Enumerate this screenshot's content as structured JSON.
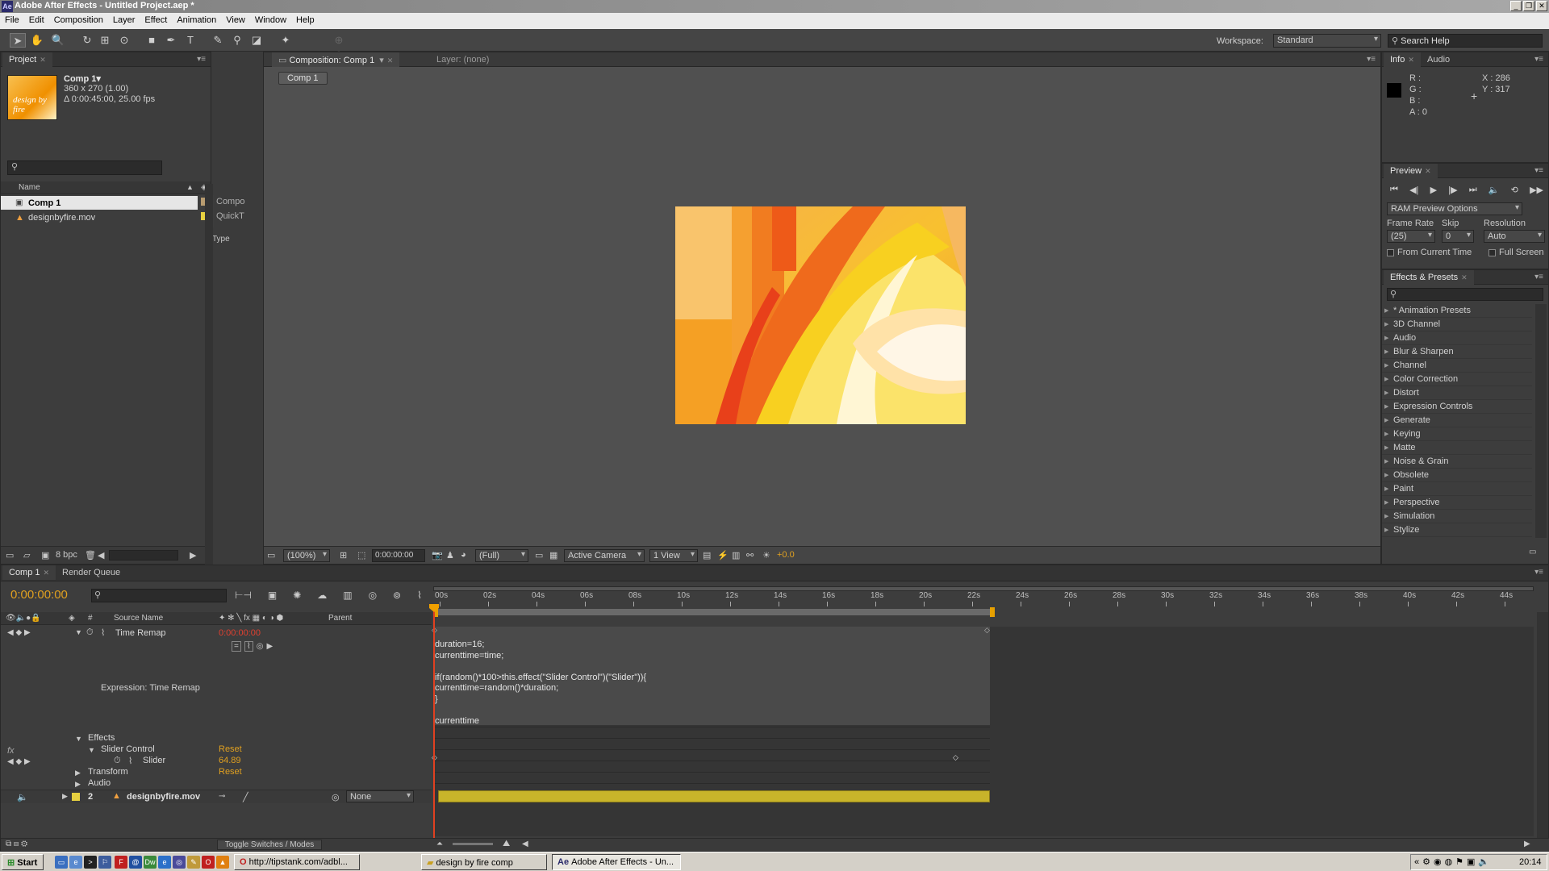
{
  "window": {
    "title": "Adobe After Effects - Untitled Project.aep *"
  },
  "menu": [
    "File",
    "Edit",
    "Composition",
    "Layer",
    "Effect",
    "Animation",
    "View",
    "Window",
    "Help"
  ],
  "toolbar": {
    "workspace_label": "Workspace:",
    "workspace_value": "Standard",
    "search_placeholder": "Search Help"
  },
  "project": {
    "tab": "Project",
    "comp_name": "Comp 1▾",
    "comp_size": "360 x 270 (1.00)",
    "comp_duration": "Δ 0:00:45:00, 25.00 fps",
    "thumb_text": "design by fire",
    "col_name": "Name",
    "col_type": "Type",
    "items": [
      {
        "name": "Comp 1",
        "type": "Compo"
      },
      {
        "name": "designbyfire.mov",
        "type": "QuickT"
      }
    ],
    "bpc": "8 bpc"
  },
  "composition": {
    "tab": "Composition: Comp 1",
    "layer_tab": "Layer: (none)",
    "subtab": "Comp 1",
    "zoom": "(100%)",
    "timecode": "0:00:00:00",
    "resolution": "(Full)",
    "camera": "Active Camera",
    "views": "1 View",
    "exposure": "+0.0"
  },
  "info": {
    "tab": "Info",
    "audio_tab": "Audio",
    "r": "R :",
    "g": "G :",
    "b": "B :",
    "a": "A : 0",
    "x": "X : 286",
    "y": "Y : 317"
  },
  "preview": {
    "tab": "Preview",
    "ram_options": "RAM Preview Options",
    "frame_rate_label": "Frame Rate",
    "skip_label": "Skip",
    "resolution_label": "Resolution",
    "frame_rate": "(25)",
    "skip": "0",
    "resolution": "Auto",
    "from_current": "From Current Time",
    "full_screen": "Full Screen"
  },
  "effects_presets": {
    "tab": "Effects & Presets",
    "items": [
      "* Animation Presets",
      "3D Channel",
      "Audio",
      "Blur & Sharpen",
      "Channel",
      "Color Correction",
      "Distort",
      "Expression Controls",
      "Generate",
      "Keying",
      "Matte",
      "Noise & Grain",
      "Obsolete",
      "Paint",
      "Perspective",
      "Simulation",
      "Stylize"
    ]
  },
  "timeline": {
    "tab": "Comp 1",
    "render_tab": "Render Queue",
    "timecode": "0:00:00:00",
    "col_source": "Source Name",
    "col_parent": "Parent",
    "time_remap": "Time Remap",
    "time_remap_value": "0:00:00:00",
    "expression_label": "Expression: Time Remap",
    "expression_lines": [
      "duration=16;",
      "currenttime=time;",
      "",
      "if(random()*100>this.effect(\"Slider Control\")(\"Slider\")){",
      "currenttime=random()*duration;",
      "}",
      "",
      "currenttime"
    ],
    "effects": "Effects",
    "slider_control": "Slider Control",
    "reset": "Reset",
    "slider": "Slider",
    "slider_value": "64.89",
    "transform": "Transform",
    "audio": "Audio",
    "layer_num": "2",
    "layer_name": "designbyfire.mov",
    "parent_value": "None",
    "toggle": "Toggle Switches / Modes",
    "ruler": [
      "00s",
      "02s",
      "04s",
      "06s",
      "08s",
      "10s",
      "12s",
      "14s",
      "16s",
      "18s",
      "20s",
      "22s",
      "24s",
      "26s",
      "28s",
      "30s",
      "32s",
      "34s",
      "36s",
      "38s",
      "40s",
      "42s",
      "44s"
    ]
  },
  "taskbar": {
    "start": "Start",
    "tasks": [
      "http://tipstank.com/adbl...",
      "design by fire comp",
      "Adobe After Effects - Un..."
    ],
    "clock": "20:14"
  },
  "colors": {
    "accent_orange": "#e0a020",
    "layer_bar": "#c8b42a",
    "cti": "#f0a000"
  }
}
